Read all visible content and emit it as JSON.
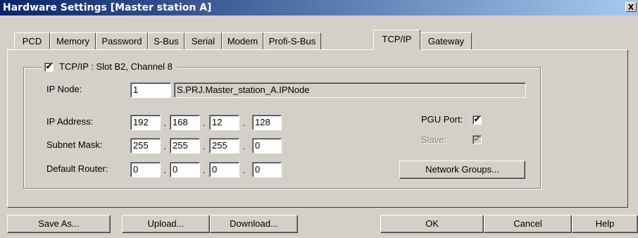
{
  "window": {
    "title": "Hardware Settings [Master station A]",
    "close_label": "X"
  },
  "tabs": [
    {
      "label": "PCD"
    },
    {
      "label": "Memory"
    },
    {
      "label": "Password"
    },
    {
      "label": "S-Bus"
    },
    {
      "label": "Serial"
    },
    {
      "label": "Modem"
    },
    {
      "label": "Profi-S-Bus"
    },
    {
      "label": "TCP/IP",
      "active": true
    },
    {
      "label": "Gateway"
    }
  ],
  "tcpip": {
    "group_label": "TCP/IP : Slot B2, Channel 8",
    "enabled": true,
    "ip_node_label": "IP Node:",
    "ip_node_value": "1",
    "ip_node_symbol": "S.PRJ.Master_station_A.IPNode",
    "ip_address_label": "IP Address:",
    "ip_address": [
      "192",
      "168",
      "12",
      "128"
    ],
    "subnet_label": "Subnet Mask:",
    "subnet": [
      "255",
      "255",
      "255",
      "0"
    ],
    "router_label": "Default Router:",
    "router": [
      "0",
      "0",
      "0",
      "0"
    ],
    "dot": ".",
    "pgu_port_label": "PGU Port:",
    "pgu_port": true,
    "slave_label": "Slave:",
    "slave": true,
    "network_groups_label": "Network Groups...",
    "check_mark": "✔"
  },
  "buttons": {
    "save_as": "Save As...",
    "upload": "Upload...",
    "download": "Download...",
    "ok": "OK",
    "cancel": "Cancel",
    "help": "Help"
  }
}
